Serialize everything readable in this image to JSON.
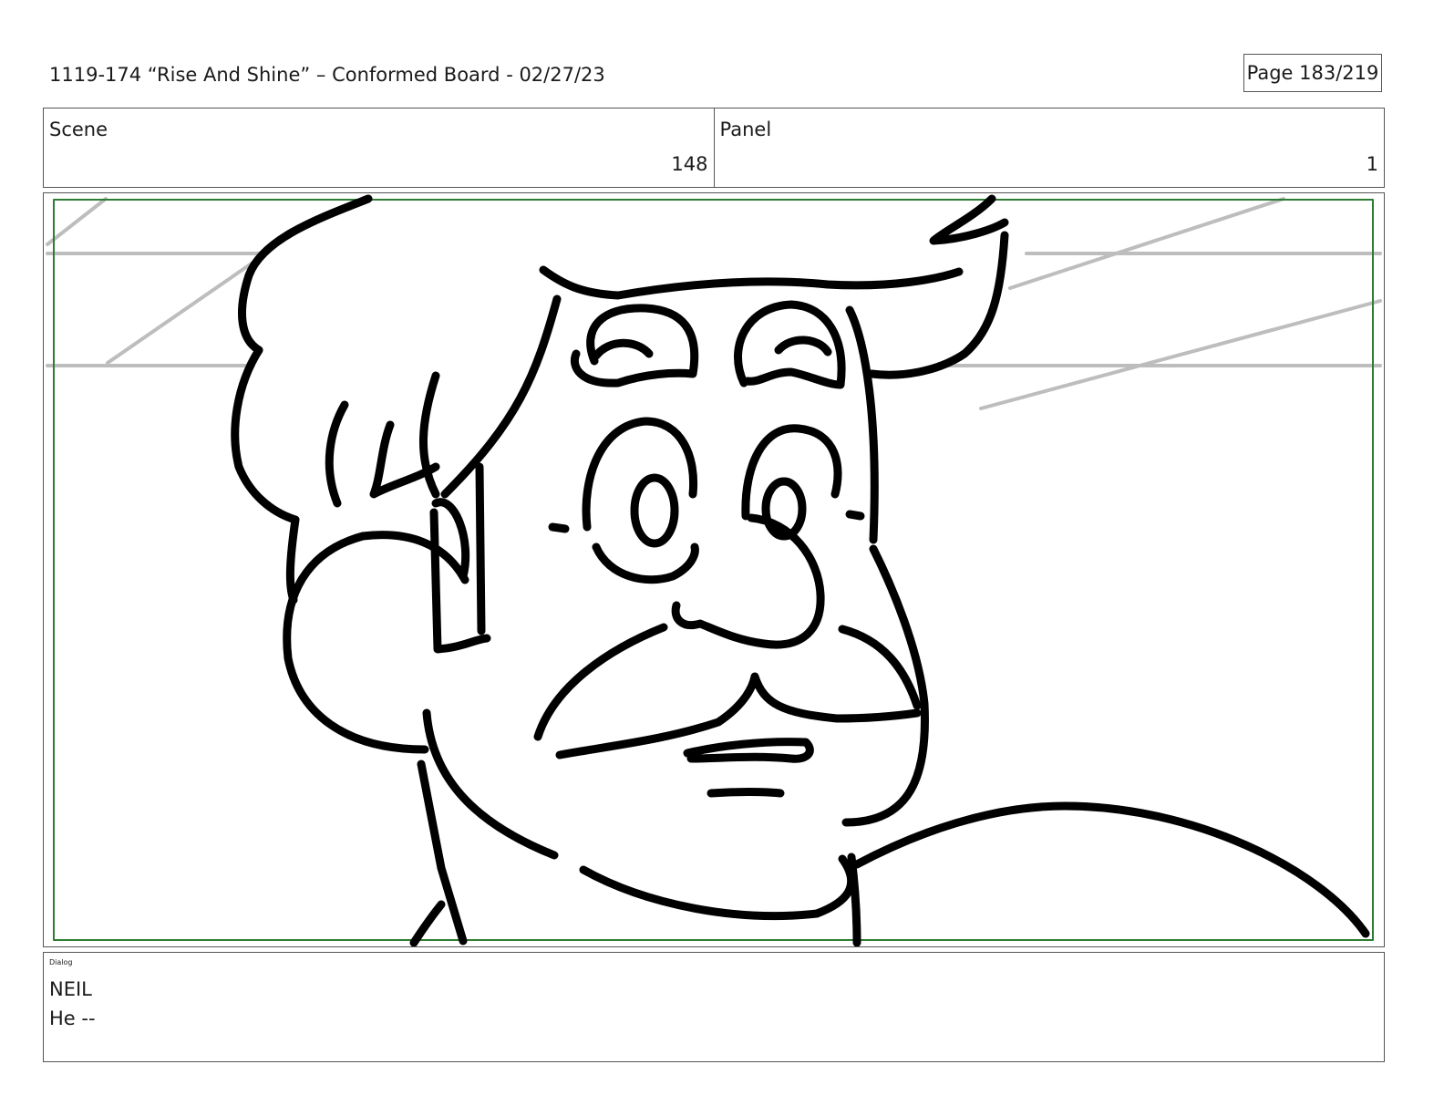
{
  "header": {
    "title": "1119-174 “Rise And Shine” – Conformed Board - 02/27/23",
    "page": "Page 183/219"
  },
  "info": {
    "scene_label": "Scene",
    "scene_value": "148",
    "panel_label": "Panel",
    "panel_value": "1"
  },
  "panel": {
    "sketch_icon": "storyboard-sketch-neil-face",
    "safe_area_color": "#2e7d32",
    "line_color": "#000000",
    "background_line_color": "#bdbdbd"
  },
  "dialog": {
    "tag": "Dialog",
    "character": "NEIL",
    "line": "He --"
  }
}
